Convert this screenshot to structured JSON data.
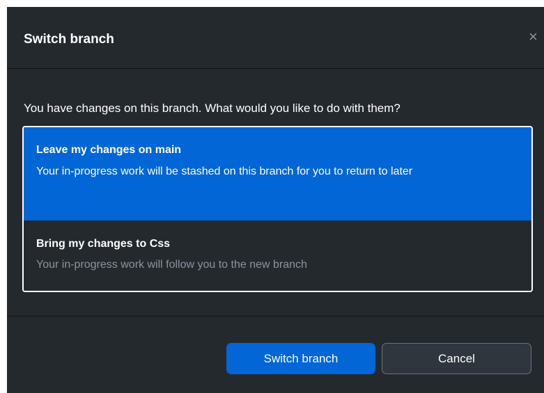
{
  "dialog": {
    "title": "Switch branch",
    "close_icon": "×",
    "prompt": "You have changes on this branch. What would you like to do with them?",
    "options": [
      {
        "title": "Leave my changes on main",
        "description": "Your in-progress work will be stashed on this branch for you to return to later",
        "selected": true
      },
      {
        "title": "Bring my changes to Css",
        "description": "Your in-progress work will follow you to the new branch",
        "selected": false
      }
    ],
    "buttons": {
      "primary": "Switch branch",
      "secondary": "Cancel"
    }
  },
  "colors": {
    "background": "#24292e",
    "accent": "#0366d6",
    "muted_text": "#8b949e"
  }
}
